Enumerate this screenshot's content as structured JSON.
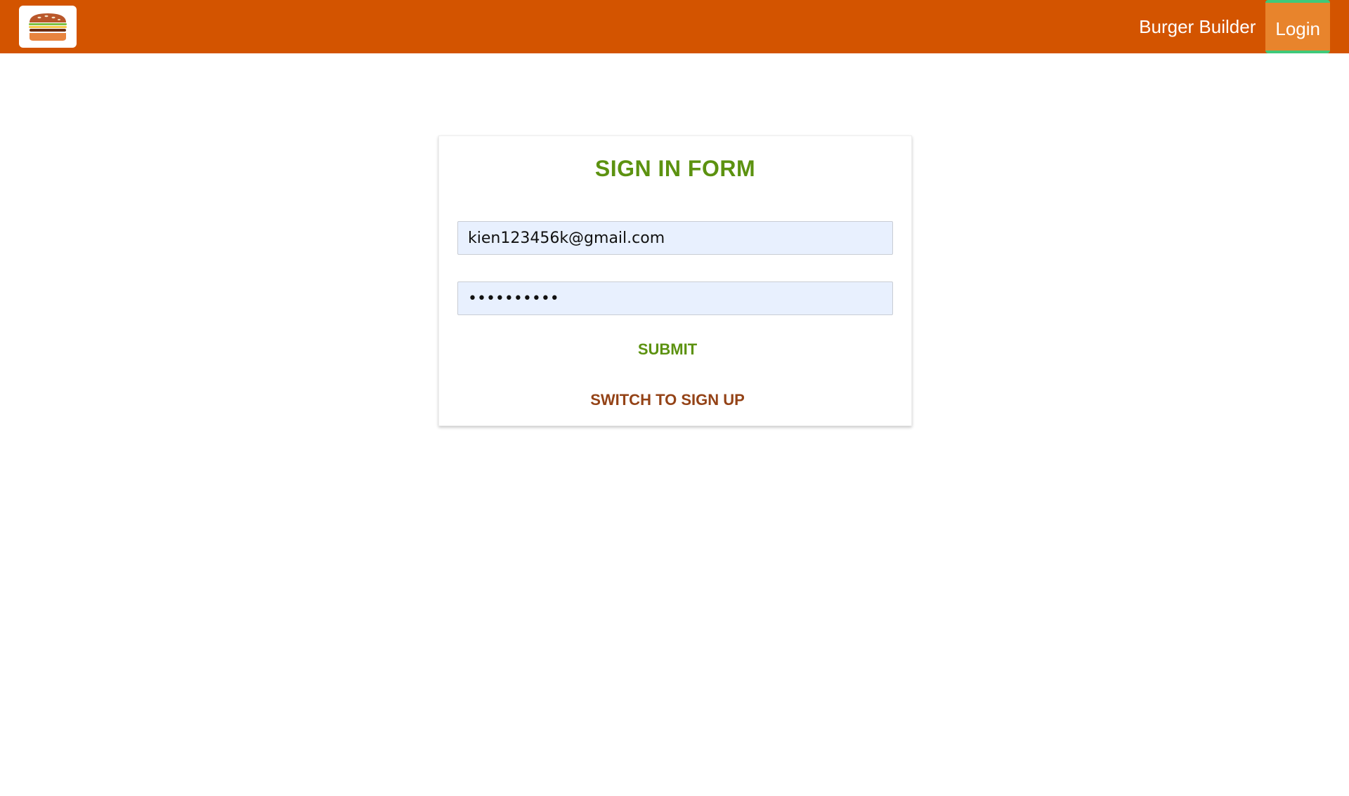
{
  "header": {
    "logo_icon": "burger-logo-icon",
    "nav": {
      "burger_builder_label": "Burger Builder",
      "login_label": "Login"
    }
  },
  "auth_form": {
    "title": "SIGN IN FORM",
    "email_value": "kien123456k@gmail.com",
    "password_masked": "••••••••••",
    "submit_label": "SUBMIT",
    "switch_label": "SWITCH TO SIGN UP"
  },
  "colors": {
    "toolbar": "#d35400",
    "active_nav": "#e8842c",
    "active_nav_border": "#3fc97a",
    "title_green": "#5c9210",
    "switch_brown": "#944317",
    "input_bg": "#e8f0fe"
  }
}
